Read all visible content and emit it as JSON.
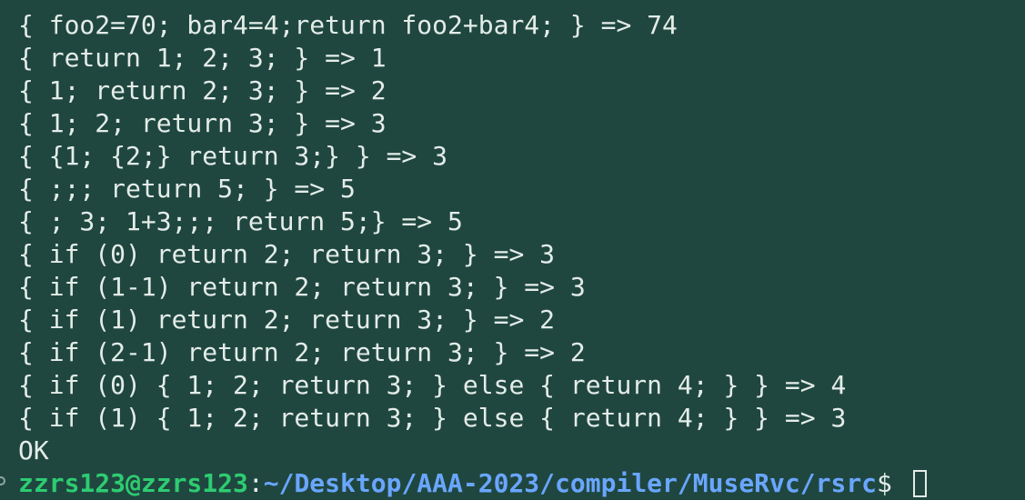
{
  "terminal": {
    "lines": [
      "{ foo2=70; bar4=4;return foo2+bar4; } => 74",
      "{ return 1; 2; 3; } => 1",
      "{ 1; return 2; 3; } => 2",
      "{ 1; 2; return 3; } => 3",
      "{ {1; {2;} return 3;} } => 3",
      "{ ;;; return 5; } => 5",
      "{ ; 3; 1+3;;; return 5;} => 5",
      "{ if (0) return 2; return 3; } => 3",
      "{ if (1-1) return 2; return 3; } => 3",
      "{ if (1) return 2; return 3; } => 2",
      "{ if (2-1) return 2; return 3; } => 2",
      "{ if (0) { 1; 2; return 3; } else { return 4; } } => 4",
      "{ if (1) { 1; 2; return 3; } else { return 4; } } => 3",
      "OK"
    ],
    "prompt": {
      "user_host": "zzrs123@zzrs123",
      "separator": ":",
      "path": "~/Desktop/AAA-2023/compiler/MuseRvc/rsrc",
      "symbol": "$ "
    },
    "colors": {
      "background": "#1f4740",
      "text": "#e4ece8",
      "user_host": "#2ecc71",
      "path": "#6aa6ff"
    }
  }
}
